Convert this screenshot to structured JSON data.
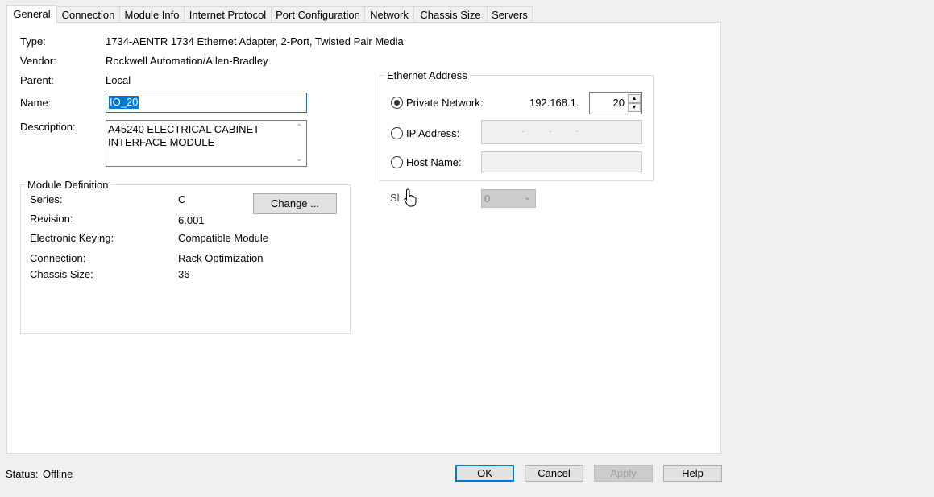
{
  "tabs": [
    "General",
    "Connection",
    "Module Info",
    "Internet Protocol",
    "Port Configuration",
    "Network",
    "Chassis Size",
    "Servers"
  ],
  "general": {
    "type_label": "Type:",
    "type_value": "1734-AENTR 1734 Ethernet Adapter, 2-Port, Twisted Pair Media",
    "vendor_label": "Vendor:",
    "vendor_value": "Rockwell Automation/Allen-Bradley",
    "parent_label": "Parent:",
    "parent_value": "Local",
    "name_label": "Name:",
    "name_value": "IO_20",
    "description_label": "Description:",
    "description_line1": "A45240 ELECTRICAL CABINET",
    "description_line2": "INTERFACE MODULE"
  },
  "module_definition": {
    "title": "Module Definition",
    "series_label": "Series:",
    "series_value": "C",
    "revision_label": "Revision:",
    "revision_value": "6.001",
    "keying_label": "Electronic Keying:",
    "keying_value": "Compatible Module",
    "connection_label": "Connection:",
    "connection_value": "Rack Optimization",
    "chassis_label": "Chassis Size:",
    "chassis_value": "36",
    "change_button": "Change ..."
  },
  "ethernet": {
    "title": "Ethernet Address",
    "private_label": "Private Network:",
    "private_prefix": "192.168.1.",
    "private_value": "20",
    "ip_label": "IP Address:",
    "ip_placeholder": ".           .           .",
    "host_label": "Host Name:",
    "selected": "private"
  },
  "slot": {
    "label": "Sl",
    "value": "0"
  },
  "status": {
    "label": "Status:",
    "value": "Offline"
  },
  "buttons": {
    "ok": "OK",
    "cancel": "Cancel",
    "apply": "Apply",
    "help": "Help"
  }
}
